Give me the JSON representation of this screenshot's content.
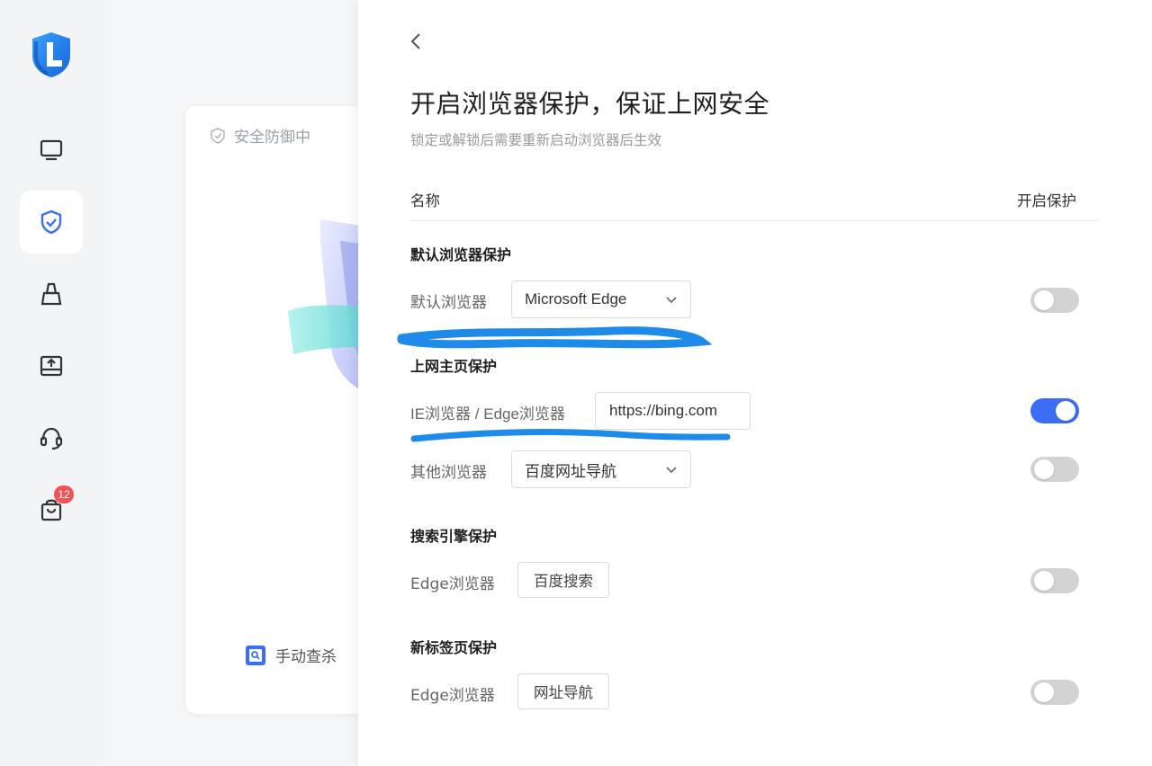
{
  "sidebar": {
    "badge_count": "12",
    "items": [
      {
        "icon": "monitor-icon"
      },
      {
        "icon": "shield-check-icon",
        "active": true
      },
      {
        "icon": "broom-icon"
      },
      {
        "icon": "drive-upload-icon"
      },
      {
        "icon": "headset-icon"
      },
      {
        "icon": "shopping-bag-icon"
      }
    ]
  },
  "card": {
    "status": "安全防御中",
    "manual_scan": "手动查杀"
  },
  "panel": {
    "title": "开启浏览器保护，保证上网安全",
    "subtitle": "锁定或解锁后需要重新启动浏览器后生效",
    "header": {
      "name": "名称",
      "protect": "开启保护"
    },
    "sections": [
      {
        "title": "默认浏览器保护",
        "rows": [
          {
            "label": "默认浏览器",
            "value": "Microsoft Edge",
            "kind": "select",
            "enabled": false
          }
        ]
      },
      {
        "title": "上网主页保护",
        "rows": [
          {
            "label": "IE浏览器 / Edge浏览器",
            "value": "https://bing.com",
            "kind": "input",
            "enabled": true
          },
          {
            "label": "其他浏览器",
            "value": "百度网址导航",
            "kind": "select",
            "enabled": false
          }
        ]
      },
      {
        "title": "搜索引擎保护",
        "rows": [
          {
            "label": "Edge浏览器",
            "value": "百度搜索",
            "kind": "chip",
            "enabled": false
          }
        ]
      },
      {
        "title": "新标签页保护",
        "rows": [
          {
            "label": "Edge浏览器",
            "value": "网址导航",
            "kind": "chip",
            "enabled": false
          }
        ]
      }
    ]
  },
  "colors": {
    "accent": "#3b6ef5",
    "toggle_off": "#d3d3d3",
    "scribble": "#1e8be8"
  }
}
